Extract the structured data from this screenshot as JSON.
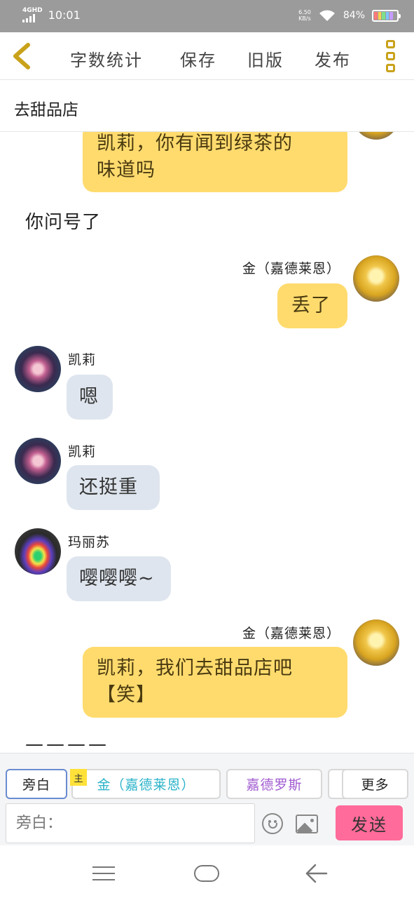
{
  "status_bar": {
    "network": "4GHD",
    "time": "10:01",
    "speed_value": "6.50",
    "speed_unit": "KB/s",
    "battery": "84%"
  },
  "toolbar": {
    "word_count_label": "字数统计",
    "save_label": "保存",
    "old_version_label": "旧版",
    "publish_label": "发布"
  },
  "story_title": "去甜品店",
  "messages": {
    "m1": {
      "text_line1": "凯莉，你有闻到绿茶的",
      "text_line2": "味道吗"
    },
    "narration1": "你问号了",
    "m2": {
      "sender": "金（嘉德莱恩）",
      "text": "丢了"
    },
    "m3": {
      "sender": "凯莉",
      "text": "嗯"
    },
    "m4": {
      "sender": "凯莉",
      "text": "还挺重"
    },
    "m5": {
      "sender": "玛丽苏",
      "text": "嘤嘤嘤~"
    },
    "m6": {
      "sender": "金（嘉德莱恩）",
      "text_line1": "凯莉，我们去甜品店吧",
      "text_line2": "【笑】"
    },
    "narration2": "————"
  },
  "roles": {
    "narrator": "旁白",
    "main_badge": "主",
    "kim": "金（嘉德莱恩）",
    "gaderos": "嘉德罗斯",
    "more": "更多"
  },
  "role_colors": {
    "kim": "#2bb3c9",
    "gaderos": "#a05bd0"
  },
  "composer": {
    "placeholder": "旁白：",
    "send_label": "发送"
  },
  "icons": {
    "back": "chevron-left-icon",
    "more": "vertical-dots-icon",
    "emoji": "emoji-icon",
    "image": "image-icon"
  }
}
